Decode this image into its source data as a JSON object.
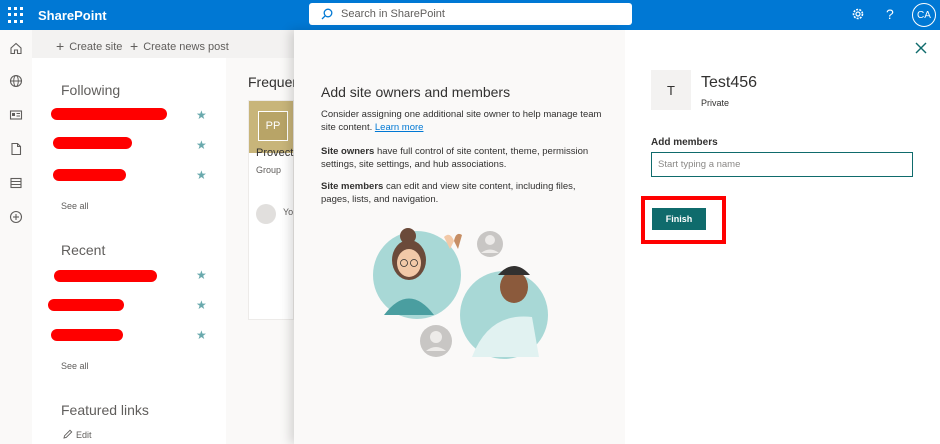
{
  "topbar": {
    "brand": "SharePoint",
    "search_placeholder": "Search in SharePoint",
    "help": "?",
    "avatar_initials": "CA",
    "icons": [
      "waffle-icon",
      "search-icon",
      "gear-icon",
      "help-icon"
    ]
  },
  "rail": {
    "icons": [
      "home-icon",
      "globe-icon",
      "news-icon",
      "document-icon",
      "list-icon",
      "add-circle-icon"
    ]
  },
  "commandbar": {
    "create_site": "Create site",
    "create_news": "Create news post"
  },
  "leftnav": {
    "following_title": "Following",
    "following_see_all": "See all",
    "recent_title": "Recent",
    "recent_see_all": "See all",
    "featured_title": "Featured links",
    "edit_label": "Edit"
  },
  "background": {
    "frequent_title": "Frequent",
    "card_initials": "PP",
    "card_name": "Provect",
    "card_type": "Group",
    "card_you": "Yo"
  },
  "illustration": {
    "heading": "Add site owners and members",
    "intro_text": "Consider assigning one additional site owner to help manage team site content.",
    "learn_more": "Learn more",
    "owners_label": "Site owners",
    "owners_text": "have full control of site content, theme, permission settings, site settings, and hub associations.",
    "members_label": "Site members",
    "members_text": "can edit and view site content, including files, pages, lists, and navigation."
  },
  "panel": {
    "site_initial": "T",
    "site_name": "Test456",
    "site_privacy": "Private",
    "add_members_label": "Add members",
    "add_members_placeholder": "Start typing a name",
    "finish_label": "Finish"
  },
  "colors": {
    "brand_blue": "#0078d4",
    "accent_teal": "#0f6b6c",
    "highlight_red": "#ff0000"
  }
}
